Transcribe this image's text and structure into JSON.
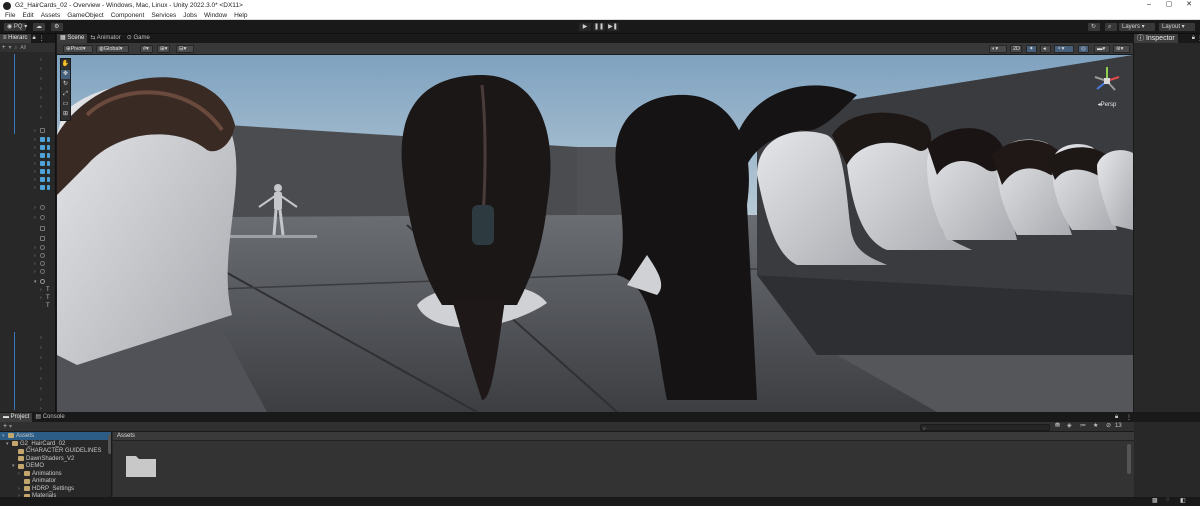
{
  "window": {
    "title": "G2_HairCards_02 - Overview - Windows, Mac, Linux - Unity 2022.3.0* <DX11>",
    "controls": [
      "–",
      "▢",
      "✕"
    ]
  },
  "menu": [
    "File",
    "Edit",
    "Assets",
    "GameObject",
    "Component",
    "Services",
    "Jobs",
    "Window",
    "Help"
  ],
  "toolbar": {
    "account": "PQ",
    "play": "▶",
    "pause": "❚❚",
    "step": "▶❚",
    "layers_label": "Layers",
    "layout_label": "Layout"
  },
  "hierarchy": {
    "tab": "Hierarc",
    "search_placeholder": "All",
    "add": "+"
  },
  "scene": {
    "tabs": [
      "Scene",
      "Animator",
      "Game"
    ],
    "pivot": "Pivot",
    "space": "Global",
    "view_mode": "2D",
    "persp_label": "Persp"
  },
  "inspector": {
    "tab": "Inspector"
  },
  "project": {
    "tabs": [
      "Project",
      "Console"
    ],
    "add": "+",
    "tree": [
      {
        "label": "Assets",
        "level": 0,
        "selected": true
      },
      {
        "label": "G2_HairCard_02",
        "level": 1,
        "selected": false
      },
      {
        "label": "CHARACTER GUIDELINES",
        "level": 2,
        "selected": false
      },
      {
        "label": "DawnShaders_V2",
        "level": 2,
        "selected": false
      },
      {
        "label": "DEMO",
        "level": 2,
        "selected": false
      },
      {
        "label": "Animations",
        "level": 3,
        "selected": false
      },
      {
        "label": "Animator",
        "level": 3,
        "selected": false
      },
      {
        "label": "HDRP_Settings",
        "level": 3,
        "selected": false
      },
      {
        "label": "Materials",
        "level": 3,
        "selected": false
      }
    ],
    "breadcrumb": "Assets",
    "hidden_count": "13"
  },
  "colors": {
    "accent": "#3a79bb",
    "folder": "#c2a66b",
    "sky_top": "#7fa2c0",
    "sky_bottom": "#b7cad6"
  }
}
